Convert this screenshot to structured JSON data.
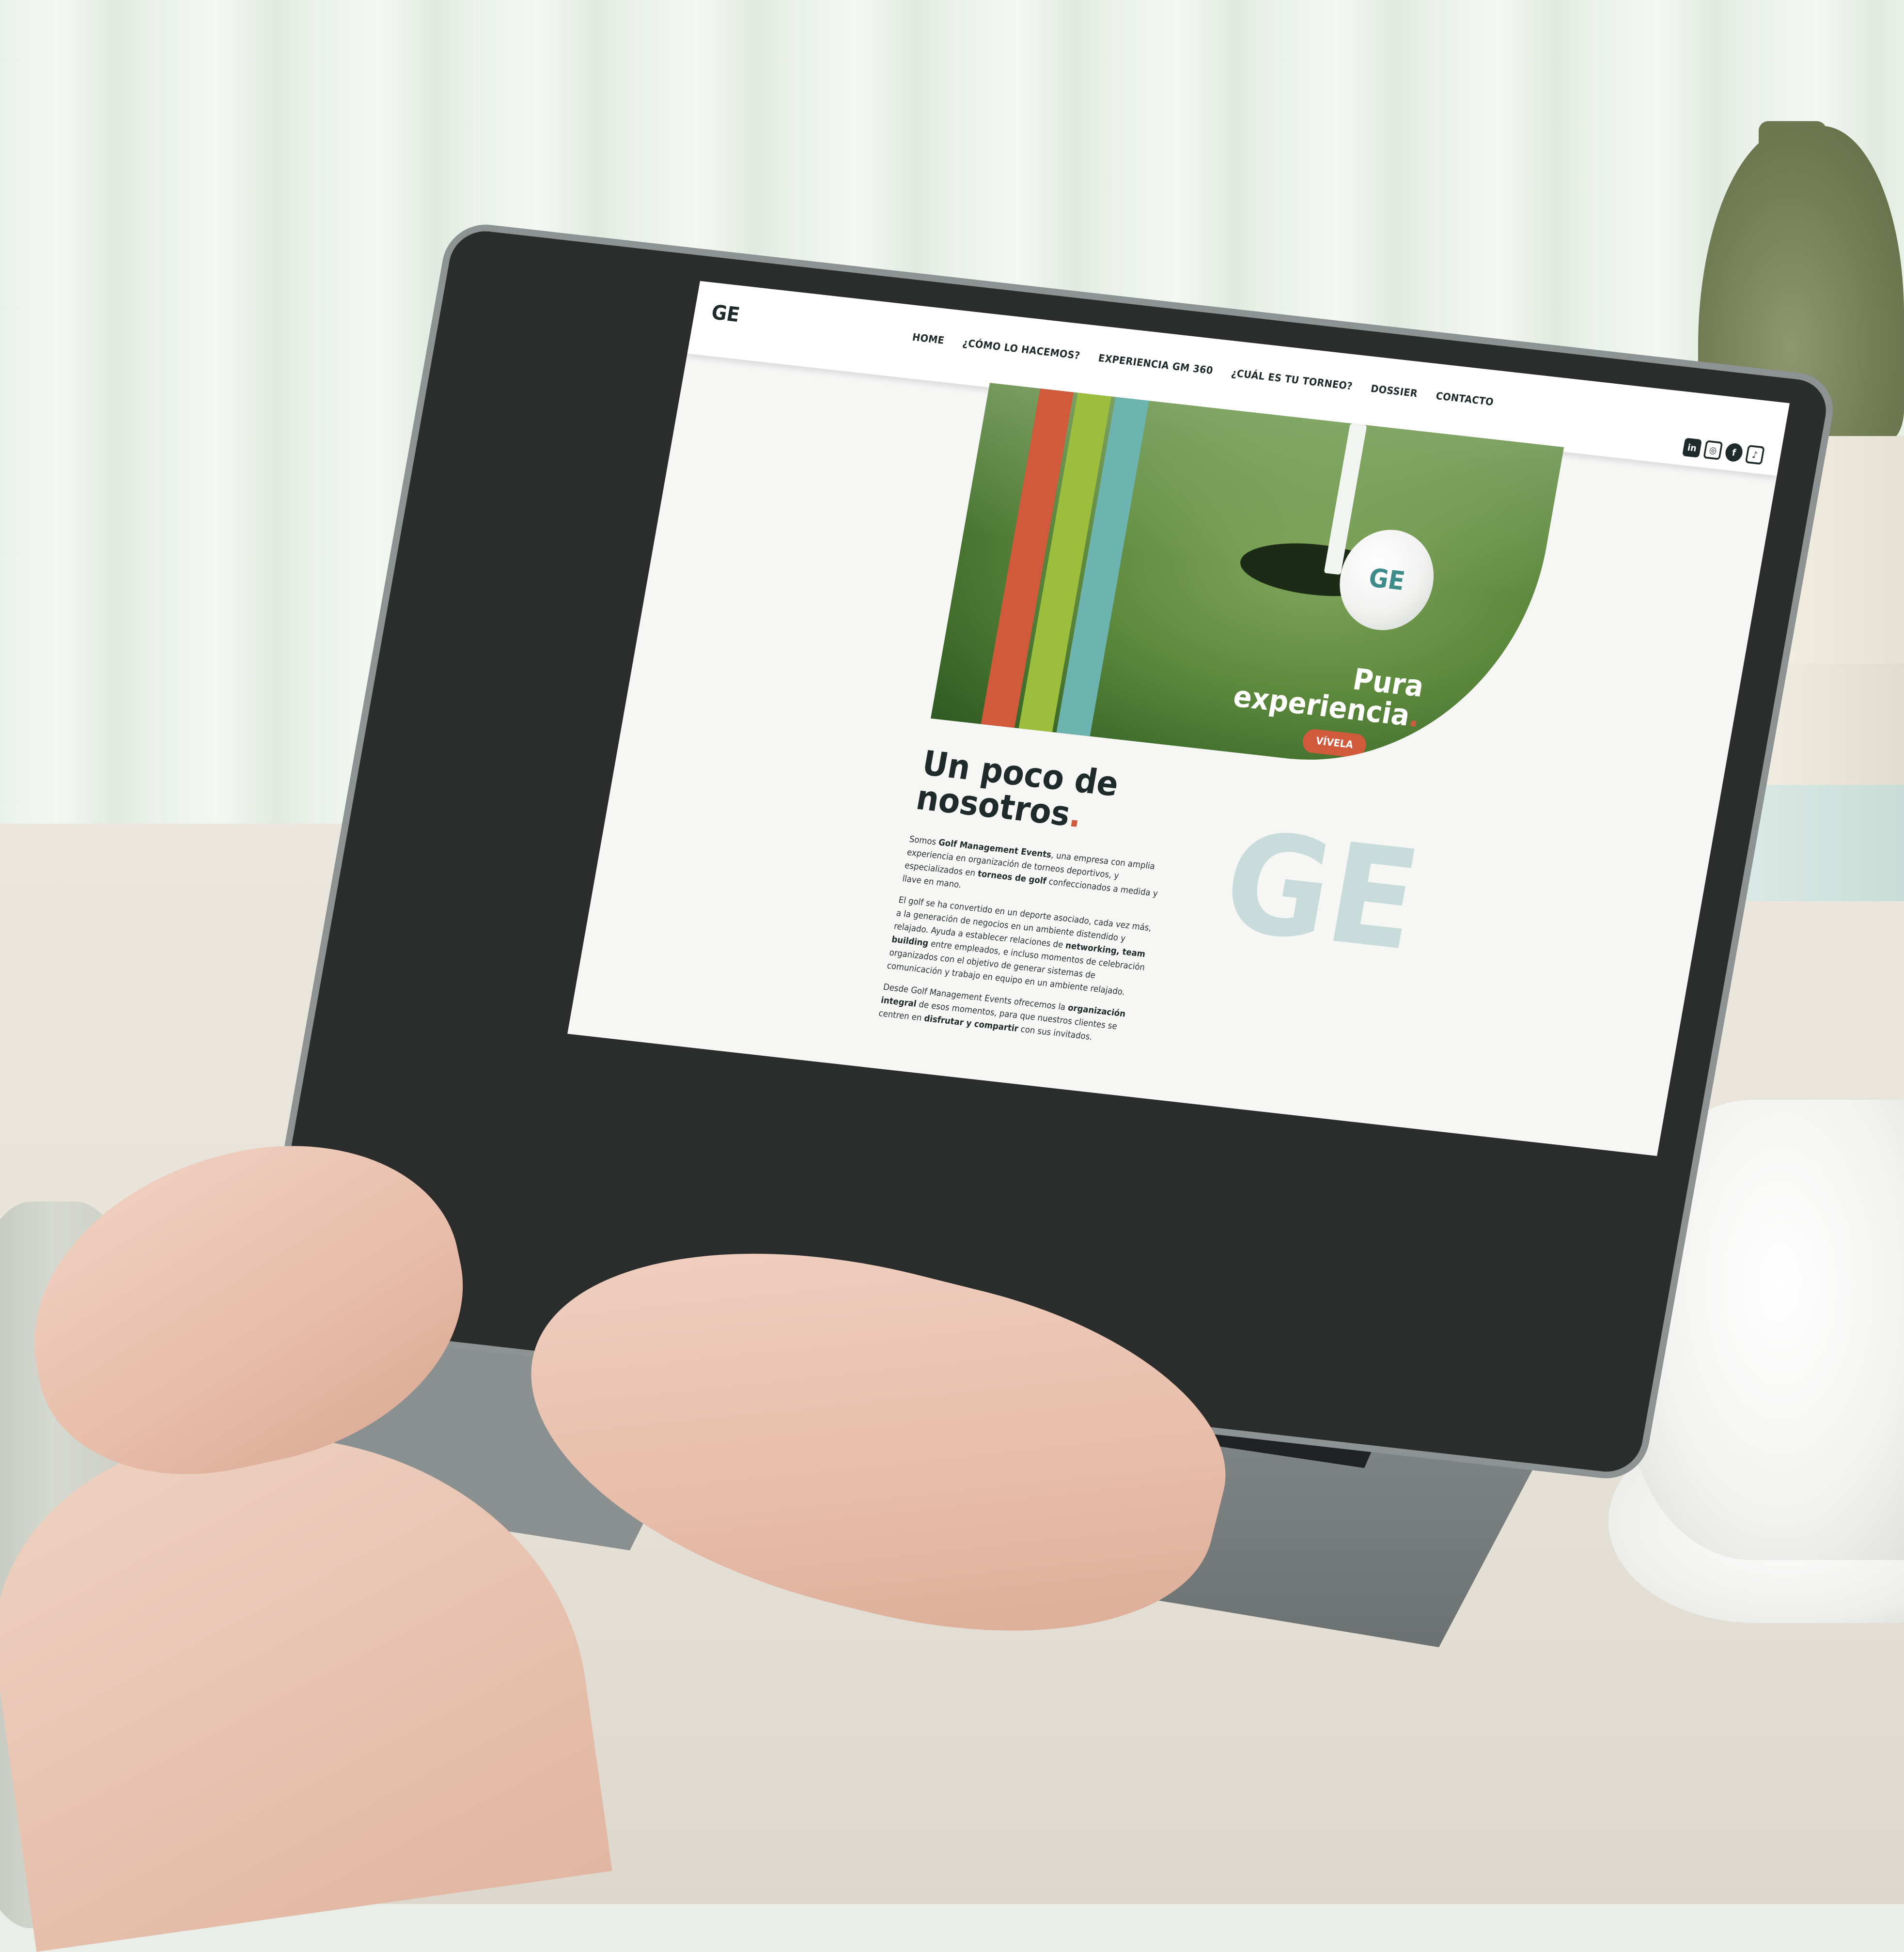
{
  "site": {
    "logo": "GE",
    "nav": [
      "HOME",
      "¿CÓMO LO HACEMOS?",
      "EXPERIENCIA GM 360",
      "¿CUÁL ES TU TORNEO?",
      "DOSSIER",
      "CONTACTO"
    ],
    "socials": [
      "in",
      "ig",
      "f",
      "tiktok"
    ],
    "social_glyphs": [
      "in",
      "◎",
      "f",
      "♪"
    ]
  },
  "hero": {
    "title_line1": "Pura",
    "title_line2": "experiencia",
    "title_dot": ".",
    "cta": "VÍVELA",
    "ball_logo": "GE",
    "colors": {
      "red": "#d25a3c",
      "lime": "#9dbd3d",
      "teal": "#6db3b0"
    }
  },
  "about": {
    "title_line1": "Un poco de",
    "title_line2": "nosotros",
    "title_dot": ".",
    "p1": {
      "a": "Somos ",
      "b": "Golf Management Events",
      "c": ", una empresa con amplia experiencia en organización de torneos deportivos, y especializados en ",
      "d": "torneos de golf",
      "e": " confeccionados a medida y llave en mano."
    },
    "p2": {
      "a": "El golf se ha convertido en un deporte asociado, cada vez más, a la generación de negocios en un ambiente distendido y relajado. Ayuda a establecer relaciones de ",
      "b": "networking, team building",
      "c": " entre empleados, e incluso momentos de celebración organizados con el objetivo de generar sistemas de comunicación y trabajo en equipo en un ambiente relajado."
    },
    "p3": {
      "a": "Desde Golf Management Events ofrecemos la ",
      "b": "organización integral",
      "c": " de esos momentos, para que nuestros clientes se centren en ",
      "d": "disfrutar y compartir",
      "e": " con sus invitados."
    },
    "watermark": "GE"
  }
}
